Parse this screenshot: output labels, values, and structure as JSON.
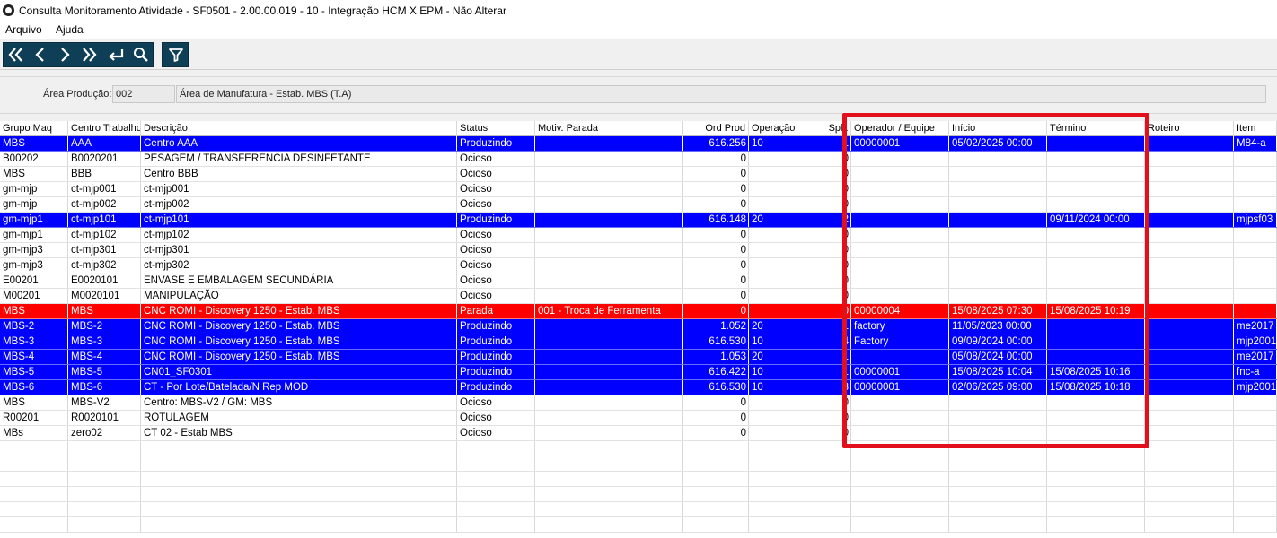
{
  "window": {
    "title": "Consulta Monitoramento Atividade - SF0501 - 2.00.00.019 - 10 - Integração HCM X EPM - Não Alterar",
    "icon": "app-logo-icon"
  },
  "menu": [
    {
      "label": "Arquivo"
    },
    {
      "label": "Ajuda"
    }
  ],
  "toolbar": {
    "buttons": [
      {
        "name": "first-record-icon"
      },
      {
        "name": "previous-record-icon"
      },
      {
        "name": "next-record-icon"
      },
      {
        "name": "last-record-icon"
      },
      {
        "name": "return-icon"
      },
      {
        "name": "search-icon"
      },
      {
        "name": "filter-icon"
      }
    ],
    "color": "#0f3f57"
  },
  "filter": {
    "area_label": "Área Produção:",
    "area_code": "002",
    "area_description": "Área de Manufatura - Estab. MBS (T.A)"
  },
  "grid": {
    "columns": [
      "Grupo Maq",
      "Centro Trabalho",
      "Descrição",
      "Status",
      "Motiv. Parada",
      "Ord Prod",
      "Operação",
      "Split",
      "Operador / Equipe",
      "Início",
      "Término",
      "Roteiro",
      "Item"
    ],
    "rows": [
      {
        "style": "blue",
        "cells": [
          "MBS",
          "AAA",
          "Centro AAA",
          "Produzindo",
          "",
          "616.256",
          "10",
          "1",
          "00000001",
          "05/02/2025 00:00",
          "",
          "",
          "M84-a"
        ]
      },
      {
        "style": "white",
        "cells": [
          "B00202",
          "B0020201",
          "PESAGEM / TRANSFERENCIA DESINFETANTE",
          "Ocioso",
          "",
          "0",
          "",
          "0",
          "",
          "",
          "",
          "",
          ""
        ]
      },
      {
        "style": "white",
        "cells": [
          "MBS",
          "BBB",
          "Centro BBB",
          "Ocioso",
          "",
          "0",
          "",
          "0",
          "",
          "",
          "",
          "",
          ""
        ]
      },
      {
        "style": "white",
        "cells": [
          "gm-mjp",
          "ct-mjp001",
          "ct-mjp001",
          "Ocioso",
          "",
          "0",
          "",
          "0",
          "",
          "",
          "",
          "",
          ""
        ]
      },
      {
        "style": "white",
        "cells": [
          "gm-mjp",
          "ct-mjp002",
          "ct-mjp002",
          "Ocioso",
          "",
          "0",
          "",
          "0",
          "",
          "",
          "",
          "",
          ""
        ]
      },
      {
        "style": "blue",
        "cells": [
          "gm-mjp1",
          "ct-mjp101",
          "ct-mjp101",
          "Produzindo",
          "",
          "616.148",
          "20",
          "2",
          "",
          "",
          "09/11/2024 00:00",
          "",
          "mjpsf03"
        ]
      },
      {
        "style": "white",
        "cells": [
          "gm-mjp1",
          "ct-mjp102",
          "ct-mjp102",
          "Ocioso",
          "",
          "0",
          "",
          "0",
          "",
          "",
          "",
          "",
          ""
        ]
      },
      {
        "style": "white",
        "cells": [
          "gm-mjp3",
          "ct-mjp301",
          "ct-mjp301",
          "Ocioso",
          "",
          "0",
          "",
          "0",
          "",
          "",
          "",
          "",
          ""
        ]
      },
      {
        "style": "white",
        "cells": [
          "gm-mjp3",
          "ct-mjp302",
          "ct-mjp302",
          "Ocioso",
          "",
          "0",
          "",
          "0",
          "",
          "",
          "",
          "",
          ""
        ]
      },
      {
        "style": "white",
        "cells": [
          "E00201",
          "E0020101",
          "ENVASE E EMBALAGEM SECUNDÁRIA",
          "Ocioso",
          "",
          "0",
          "",
          "0",
          "",
          "",
          "",
          "",
          ""
        ]
      },
      {
        "style": "white",
        "cells": [
          "M00201",
          "M0020101",
          "MANIPULAÇÃO",
          "Ocioso",
          "",
          "0",
          "",
          "0",
          "",
          "",
          "",
          "",
          ""
        ]
      },
      {
        "style": "red",
        "cells": [
          "MBS",
          "MBS",
          "CNC ROMI - Discovery 1250 - Estab. MBS",
          "Parada",
          "001      - Troca de Ferramenta",
          "0",
          "",
          "0",
          "00000004",
          "15/08/2025 07:30",
          "15/08/2025 10:19",
          "",
          ""
        ]
      },
      {
        "style": "blue",
        "cells": [
          "MBS-2",
          "MBS-2",
          "CNC ROMI - Discovery 1250 - Estab. MBS",
          "Produzindo",
          "",
          "1.052",
          "20",
          "1",
          "factory",
          "11/05/2023 00:00",
          "",
          "",
          "me2017"
        ]
      },
      {
        "style": "blue",
        "cells": [
          "MBS-3",
          "MBS-3",
          "CNC ROMI - Discovery 1250 - Estab. MBS",
          "Produzindo",
          "",
          "616.530",
          "10",
          "4",
          "Factory",
          "09/09/2024 00:00",
          "",
          "",
          "mjp2001"
        ]
      },
      {
        "style": "blue",
        "cells": [
          "MBS-4",
          "MBS-4",
          "CNC ROMI - Discovery 1250 - Estab. MBS",
          "Produzindo",
          "",
          "1.053",
          "20",
          "1",
          "",
          "05/08/2024 00:00",
          "",
          "",
          "me2017"
        ]
      },
      {
        "style": "blue",
        "cells": [
          "MBS-5",
          "MBS-5",
          "CN01_SF0301",
          "Produzindo",
          "",
          "616.422",
          "10",
          "1",
          "00000001",
          "15/08/2025 10:04",
          "15/08/2025 10:16",
          "",
          "fnc-a"
        ]
      },
      {
        "style": "blue",
        "cells": [
          "MBS-6",
          "MBS-6",
          "CT - Por Lote/Batelada/N Rep MOD",
          "Produzindo",
          "",
          "616.530",
          "10",
          "3",
          "00000001",
          "02/06/2025 09:00",
          "15/08/2025 10:18",
          "",
          "mjp2001"
        ]
      },
      {
        "style": "white",
        "cells": [
          "MBS",
          "MBS-V2",
          "Centro: MBS-V2 / GM: MBS",
          "Ocioso",
          "",
          "0",
          "",
          "0",
          "",
          "",
          "",
          "",
          ""
        ]
      },
      {
        "style": "white",
        "cells": [
          "R00201",
          "R0020101",
          "ROTULAGEM",
          "Ocioso",
          "",
          "0",
          "",
          "0",
          "",
          "",
          "",
          "",
          ""
        ]
      },
      {
        "style": "white",
        "cells": [
          "MBs",
          "zero02",
          "CT 02 - Estab MBS",
          "Ocioso",
          "",
          "0",
          "",
          "0",
          "",
          "",
          "",
          "",
          ""
        ]
      }
    ],
    "empty_rows": 6
  },
  "colors": {
    "producing_row": "#0000ff",
    "stopped_row": "#ff0000",
    "highlight": "#e3101b"
  }
}
